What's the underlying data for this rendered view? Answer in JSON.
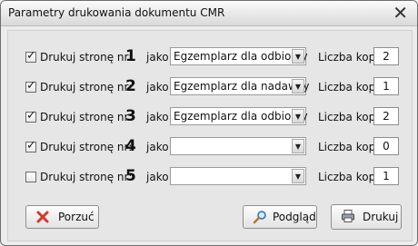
{
  "window": {
    "title": "Parametry drukowania dokumentu CMR",
    "close_glyph": "✕"
  },
  "rows": [
    {
      "checked": true,
      "label": "Drukuj stronę nr:",
      "number": "1",
      "jako": "jako",
      "option": "Egzemplarz dla odbiorcy",
      "copies_label": "Liczba kopii:",
      "copies": "2"
    },
    {
      "checked": true,
      "label": "Drukuj stronę nr:",
      "number": "2",
      "jako": "jako",
      "option": "Egzemplarz dla nadawcy",
      "copies_label": "Liczba kopii:",
      "copies": "1"
    },
    {
      "checked": true,
      "label": "Drukuj stronę nr:",
      "number": "3",
      "jako": "jako",
      "option": "Egzemplarz dla odbiorcy",
      "copies_label": "Liczba kopii:",
      "copies": "2"
    },
    {
      "checked": true,
      "label": "Drukuj stronę nr:",
      "number": "4",
      "jako": "jako",
      "option": "",
      "copies_label": "Liczba kopii:",
      "copies": "0"
    },
    {
      "checked": false,
      "label": "Drukuj stronę nr:",
      "number": "5",
      "jako": "jako",
      "option": "",
      "copies_label": "Liczba kopii:",
      "copies": "1"
    }
  ],
  "buttons": {
    "cancel": "Porzuć",
    "preview": "Podgląd",
    "print": "Drukuj"
  },
  "icons": {
    "cancel": "red-x-icon",
    "preview": "magnifier-icon",
    "print": "printer-icon"
  },
  "colors": {
    "cancel_icon": "#d23a2a",
    "preview_icon": "#2b6fb8"
  }
}
